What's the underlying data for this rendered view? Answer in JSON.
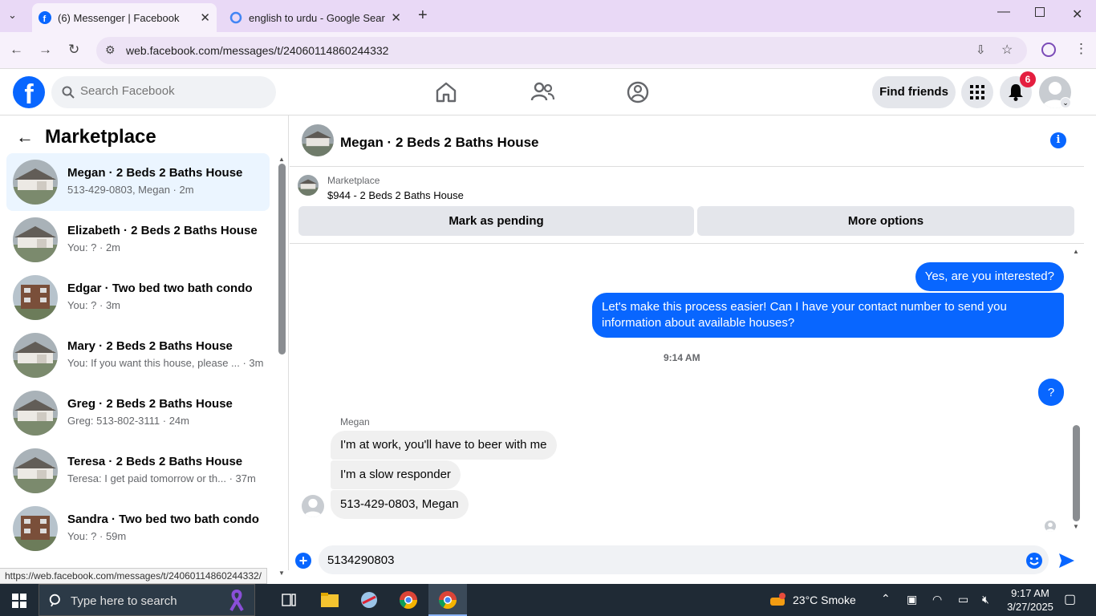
{
  "browser": {
    "tabs": [
      {
        "title": "(6) Messenger | Facebook",
        "active": true
      },
      {
        "title": "english to urdu - Google Search",
        "active": false
      }
    ],
    "url": "web.facebook.com/messages/t/24060114860244332",
    "status_url": "https://web.facebook.com/messages/t/24060114860244332/"
  },
  "header": {
    "search_placeholder": "Search Facebook",
    "find_friends": "Find friends",
    "notification_count": "6"
  },
  "sidebar": {
    "title": "Marketplace",
    "conversations": [
      {
        "name": "Megan · 2 Beds 2 Baths House",
        "preview": "513-429-0803, Megan · 2m",
        "avatar": "house"
      },
      {
        "name": "Elizabeth · 2 Beds 2 Baths House",
        "preview": "You: ? · 2m",
        "avatar": "house"
      },
      {
        "name": "Edgar · Two bed two bath condo",
        "preview": "You: ? · 3m",
        "avatar": "condo"
      },
      {
        "name": "Mary · 2 Beds 2 Baths House",
        "preview": "You: If you want this house, please ... · 3m",
        "avatar": "house"
      },
      {
        "name": "Greg · 2 Beds 2 Baths House",
        "preview": "Greg: 513-802-3111 · 24m",
        "avatar": "house"
      },
      {
        "name": "Teresa · 2 Beds 2 Baths House",
        "preview": "Teresa: I get paid tomorrow or th... · 37m",
        "avatar": "house"
      },
      {
        "name": "Sandra · Two bed two bath condo",
        "preview": "You: ? · 59m",
        "avatar": "condo"
      }
    ]
  },
  "chat": {
    "title": "Megan · 2 Beds 2 Baths House",
    "marketplace_label": "Marketplace",
    "listing": "$944 - 2 Beds 2 Baths House",
    "mark_pending": "Mark as pending",
    "more_options": "More options",
    "messages_out": [
      "Yes, are you interested?",
      "Let's make this process easier! Can I have your contact number to send you information about available houses?",
      "?"
    ],
    "timestamp": "9:14 AM",
    "sender": "Megan",
    "messages_in": [
      "I'm at work, you'll have to beer with me",
      "I'm a slow responder",
      "513-429-0803, Megan"
    ],
    "composer_value": "5134290803"
  },
  "taskbar": {
    "search_placeholder": "Type here to search",
    "weather": "23°C  Smoke",
    "time": "9:17 AM",
    "date": "3/27/2025"
  },
  "colors": {
    "fb_blue": "#0866ff",
    "tab_bar": "#e9d9f6",
    "taskbar": "#1f2a35"
  }
}
